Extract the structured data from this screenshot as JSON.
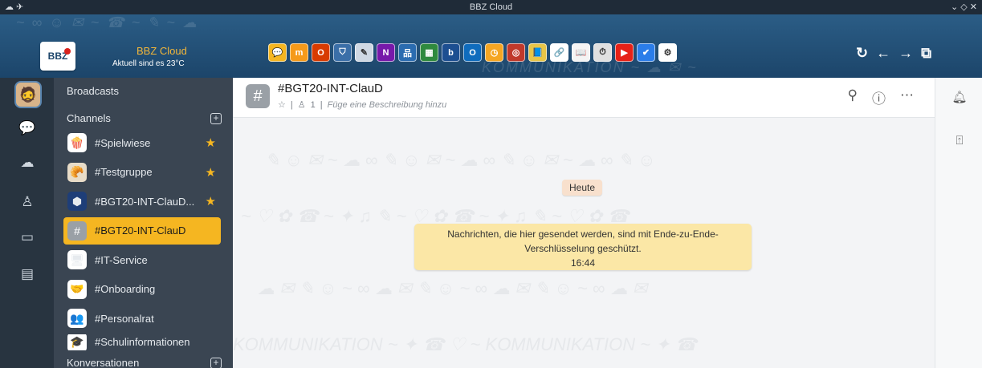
{
  "titlebar": {
    "title": "BBZ Cloud",
    "left_icons": "☁ ✈",
    "right_icons": "⌄ ◇ ✕"
  },
  "header": {
    "logo_text": "BBZ",
    "brand_name": "BBZ Cloud",
    "weather": "Aktuell sind es 23°C",
    "apps": [
      {
        "name": "chat",
        "bg": "#f5b621",
        "glyph": "💬"
      },
      {
        "name": "moodle",
        "bg": "#f59a1a",
        "glyph": "m"
      },
      {
        "name": "office",
        "bg": "#d83b01",
        "glyph": "O"
      },
      {
        "name": "crest",
        "bg": "#3b6fa8",
        "glyph": "⛉"
      },
      {
        "name": "pencil",
        "bg": "#cfd8e3",
        "glyph": "✎"
      },
      {
        "name": "onenote",
        "bg": "#7719aa",
        "glyph": "N"
      },
      {
        "name": "network",
        "bg": "#2b6cb0",
        "glyph": "品"
      },
      {
        "name": "board",
        "bg": "#2f8a3e",
        "glyph": "▦"
      },
      {
        "name": "bbb",
        "bg": "#1d4f91",
        "glyph": "b"
      },
      {
        "name": "outlook",
        "bg": "#0f6cbd",
        "glyph": "O"
      },
      {
        "name": "clock",
        "bg": "#f5a623",
        "glyph": "◷"
      },
      {
        "name": "target",
        "bg": "#c0392b",
        "glyph": "◎"
      },
      {
        "name": "book",
        "bg": "#e8c547",
        "glyph": "📘"
      },
      {
        "name": "link",
        "bg": "#ffffff",
        "glyph": "🔗"
      },
      {
        "name": "reader",
        "bg": "#f4f4f4",
        "glyph": "📖"
      },
      {
        "name": "gauge",
        "bg": "#e0e0e0",
        "glyph": "⏱"
      },
      {
        "name": "youtube",
        "bg": "#e62117",
        "glyph": "▶"
      },
      {
        "name": "check",
        "bg": "#2b7de9",
        "glyph": "✔"
      },
      {
        "name": "gear",
        "bg": "#ffffff",
        "glyph": "⚙"
      }
    ],
    "nav": [
      "↻",
      "←",
      "→",
      "⧉"
    ]
  },
  "rail": {
    "avatar": "🧔",
    "items": [
      {
        "name": "chat-icon",
        "glyph": "💬",
        "active": true
      },
      {
        "name": "cloud-icon",
        "glyph": "☁",
        "active": false
      },
      {
        "name": "contact-icon",
        "glyph": "♙",
        "active": false
      },
      {
        "name": "calendar-icon",
        "glyph": "▭",
        "active": false
      },
      {
        "name": "clipboard-icon",
        "glyph": "▤",
        "active": false
      }
    ]
  },
  "sidebar": {
    "broadcasts": "Broadcasts",
    "channels": "Channels",
    "conversations": "Konversationen",
    "items": [
      {
        "label": "#Spielwiese",
        "thumb": "🍿",
        "thumb_bg": "#ffffff",
        "star": true,
        "active": false
      },
      {
        "label": "#Testgruppe",
        "thumb": "🥐",
        "thumb_bg": "#e8dcc8",
        "star": true,
        "active": false
      },
      {
        "label": "#BGT20-INT-ClauD...",
        "thumb": "⬢",
        "thumb_bg": "#1e3e78",
        "star": true,
        "active": false
      },
      {
        "label": "#BGT20-INT-ClauD",
        "thumb": "#",
        "thumb_bg": "#9aa0a6",
        "star": false,
        "active": true
      },
      {
        "label": "#IT-Service",
        "thumb": "🖥",
        "thumb_bg": "#ffffff",
        "star": false,
        "active": false
      },
      {
        "label": "#Onboarding",
        "thumb": "🤝",
        "thumb_bg": "#ffffff",
        "star": false,
        "active": false
      },
      {
        "label": "#Personalrat",
        "thumb": "👥",
        "thumb_bg": "#ffffff",
        "star": false,
        "active": false
      },
      {
        "label": "#Schulinformationen",
        "thumb": "🎓",
        "thumb_bg": "#ffffff",
        "star": false,
        "active": false
      }
    ]
  },
  "chat": {
    "title": "#BGT20-INT-ClauD",
    "member_count": "1",
    "description": "Füge eine Beschreibung hinzu",
    "date_label": "Heute",
    "notice_line1": "Nachrichten, die hier gesendet werden, sind mit Ende-zu-Ende-",
    "notice_line2": "Verschlüsselung geschützt.",
    "notice_time": "16:44"
  },
  "colors": {
    "accent": "#f5b621",
    "rail": "#283440",
    "sidebar": "#3a4552",
    "banner": "#1c456a"
  }
}
